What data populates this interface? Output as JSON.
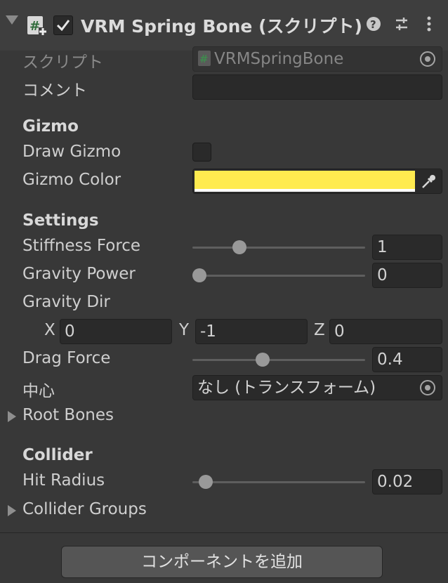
{
  "header": {
    "title": "VRM Spring Bone (スクリプト)",
    "enabled": true,
    "icons": [
      "foldout-arrow-icon",
      "script-add-icon",
      "help-icon",
      "preset-icon",
      "more-menu-icon"
    ]
  },
  "script_field": {
    "label": "スクリプト",
    "value": "VRMSpringBone"
  },
  "comment_field": {
    "label": "コメント",
    "value": ""
  },
  "gizmo": {
    "section": "Gizmo",
    "draw_label": "Draw Gizmo",
    "draw_value": false,
    "color_label": "Gizmo Color",
    "color_value": "#ffeb4f"
  },
  "settings": {
    "section": "Settings",
    "stiffness_label": "Stiffness Force",
    "stiffness_value": "1",
    "stiffness_fraction": 0.25,
    "gravity_power_label": "Gravity Power",
    "gravity_power_value": "0",
    "gravity_power_fraction": 0.0,
    "gravity_dir_label": "Gravity Dir",
    "x_label": "X",
    "x_value": "0",
    "y_label": "Y",
    "y_value": "-1",
    "z_label": "Z",
    "z_value": "0",
    "drag_label": "Drag Force",
    "drag_value": "0.4",
    "drag_fraction": 0.4,
    "center_label": "中心",
    "center_value": "なし (トランスフォーム)",
    "root_bones_label": "Root Bones"
  },
  "collider": {
    "section": "Collider",
    "hit_radius_label": "Hit Radius",
    "hit_radius_value": "0.02",
    "hit_radius_fraction": 0.04,
    "collider_groups_label": "Collider Groups"
  },
  "add_component_label": "コンポーネントを追加",
  "colors": {
    "background": "#383838",
    "header": "#3e3e3e",
    "field": "#2a2a2a",
    "button": "#555555",
    "gizmo_yellow": "#ffeb4f"
  }
}
